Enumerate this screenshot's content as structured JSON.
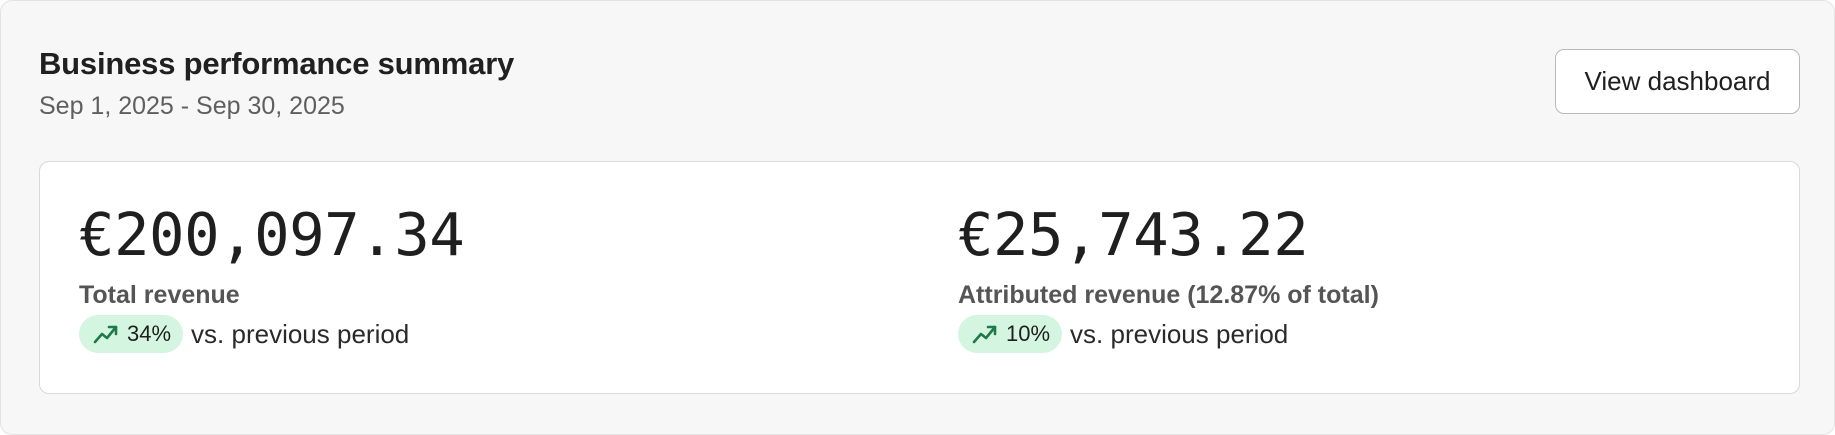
{
  "header": {
    "title": "Business performance summary",
    "date_range": "Sep 1, 2025 - Sep 30, 2025",
    "view_button_label": "View dashboard"
  },
  "metrics": [
    {
      "value": "€200,097.34",
      "label": "Total revenue",
      "change": "34%",
      "change_icon": "trending-up-icon",
      "comparison": "vs. previous period"
    },
    {
      "value": "€25,743.22",
      "label": "Attributed revenue (12.87% of total)",
      "change": "10%",
      "change_icon": "trending-up-icon",
      "comparison": "vs. previous period"
    }
  ],
  "colors": {
    "badge_background": "#d4f5df",
    "trend_icon": "#1f7a4a"
  }
}
